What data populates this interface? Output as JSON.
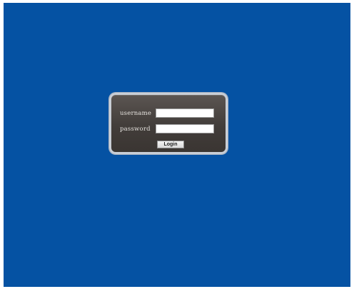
{
  "login": {
    "username_label": "username",
    "username_value": "",
    "password_label": "password",
    "password_value": "",
    "login_button_label": "Login"
  },
  "colors": {
    "background": "#0552a3",
    "panel": "#423d3a",
    "panel_border": "#c9ced6"
  }
}
